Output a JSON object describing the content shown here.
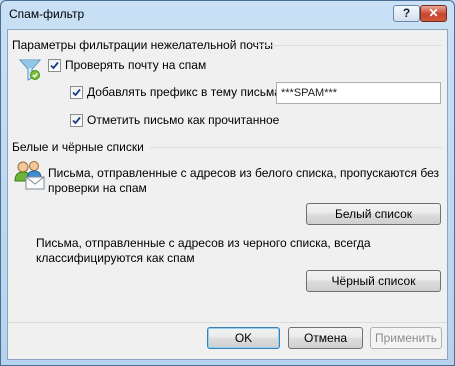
{
  "window": {
    "title": "Спам-фильтр",
    "help_label": "?",
    "close_label": "✕"
  },
  "filter_group": {
    "header": "Параметры фильтрации нежелательной почты",
    "icon": "funnel-icon",
    "check_spam": {
      "label": "Проверять почту на спам",
      "checked": true
    },
    "add_prefix": {
      "label": "Добавлять префикс в тему письма",
      "checked": true,
      "value": "***SPAM***"
    },
    "mark_read": {
      "label": "Отметить письмо как прочитанное",
      "checked": true
    }
  },
  "lists_group": {
    "header": "Белые и чёрные списки",
    "icon": "users-mail-icon",
    "white_text": "Письма, отправленные с адресов из белого списка, пропускаются без проверки на спам",
    "white_button": "Белый список",
    "black_text": "Письма, отправленные с адресов из черного списка, всегда классифицируются как спам",
    "black_button": "Чёрный список"
  },
  "footer": {
    "ok": "OK",
    "cancel": "Отмена",
    "apply": "Применить",
    "apply_enabled": false
  }
}
